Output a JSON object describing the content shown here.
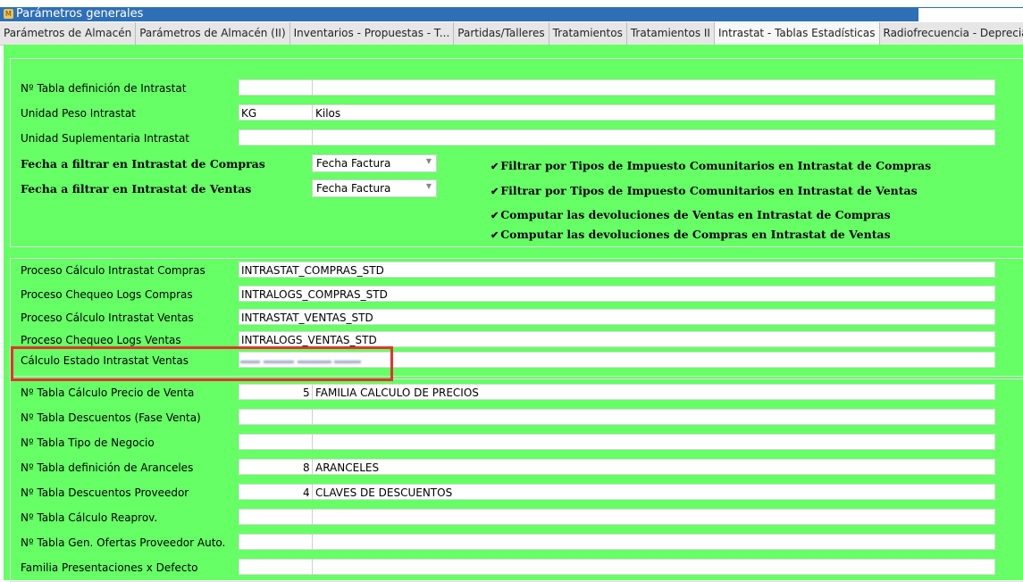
{
  "window": {
    "title": "Parámetros generales"
  },
  "tabs": [
    {
      "label": "Parámetros de Almacén"
    },
    {
      "label": "Parámetros de Almacén (II)"
    },
    {
      "label": "Inventarios - Propuestas - T..."
    },
    {
      "label": "Partidas/Talleres"
    },
    {
      "label": "Tratamientos"
    },
    {
      "label": "Tratamientos II"
    },
    {
      "label": "Intrastat - Tablas Estadísticas"
    },
    {
      "label": "Radiofrecuencia - Deprecia"
    }
  ],
  "section1": {
    "tabla_intrastat": {
      "label": "Nº Tabla definición de Intrastat",
      "code": "",
      "desc": ""
    },
    "unidad_peso": {
      "label": "Unidad Peso Intrastat",
      "code": "KG",
      "desc": "Kilos"
    },
    "unidad_suplementaria": {
      "label": "Unidad Suplementaria Intrastat",
      "code": "",
      "desc": ""
    },
    "fecha_compras": {
      "label": "Fecha a filtrar en Intrastat de Compras",
      "value": "Fecha Factura"
    },
    "fecha_ventas": {
      "label": "Fecha a filtrar en Intrastat de Ventas",
      "value": "Fecha Factura"
    },
    "checks": [
      {
        "label": "Filtrar por Tipos de Impuesto Comunitarios en Intrastat de Compras",
        "checked": true
      },
      {
        "label": "Filtrar por Tipos de Impuesto Comunitarios en Intrastat de Ventas",
        "checked": true
      },
      {
        "label": "Computar las devoluciones de Ventas en Intrastat de Compras",
        "checked": true
      },
      {
        "label": "Computar las devoluciones de Compras en Intrastat de Ventas",
        "checked": true
      }
    ]
  },
  "section2": {
    "rows": [
      {
        "label": "Proceso Cálculo Intrastat Compras",
        "value": "INTRASTAT_COMPRAS_STD"
      },
      {
        "label": "Proceso Chequeo Logs Compras",
        "value": "INTRALOGS_COMPRAS_STD"
      },
      {
        "label": "Proceso Cálculo Intrastat Ventas",
        "value": "INTRASTAT_VENTAS_STD"
      },
      {
        "label": "Proceso Chequeo Logs Ventas",
        "value": "INTRALOGS_VENTAS_STD"
      },
      {
        "label": "Cálculo Estado Intrastat Ventas",
        "value": ""
      }
    ]
  },
  "section3": {
    "rows": [
      {
        "label": "Nº Tabla Cálculo Precio de Venta",
        "code": "5",
        "desc": "FAMILIA CALCULO DE PRECIOS"
      },
      {
        "label": "Nº Tabla Descuentos (Fase Venta)",
        "code": "",
        "desc": ""
      },
      {
        "label": "Nº Tabla Tipo de Negocio",
        "code": "",
        "desc": ""
      },
      {
        "label": "Nº Tabla definición de Aranceles",
        "code": "8",
        "desc": "ARANCELES"
      },
      {
        "label": "Nº Tabla Descuentos Proveedor",
        "code": "4",
        "desc": "CLAVES DE DESCUENTOS"
      },
      {
        "label": "Nº Tabla Cálculo Reaprov.",
        "code": "",
        "desc": ""
      },
      {
        "label": "Nº Tabla Gen. Ofertas Proveedor Auto.",
        "code": "",
        "desc": ""
      },
      {
        "label": "Familia Presentaciones x Defecto",
        "code": "",
        "desc": ""
      }
    ]
  },
  "colors": {
    "background": "#66ff66",
    "titlebar": "#2f6fb6",
    "highlight": "#e0342c"
  }
}
